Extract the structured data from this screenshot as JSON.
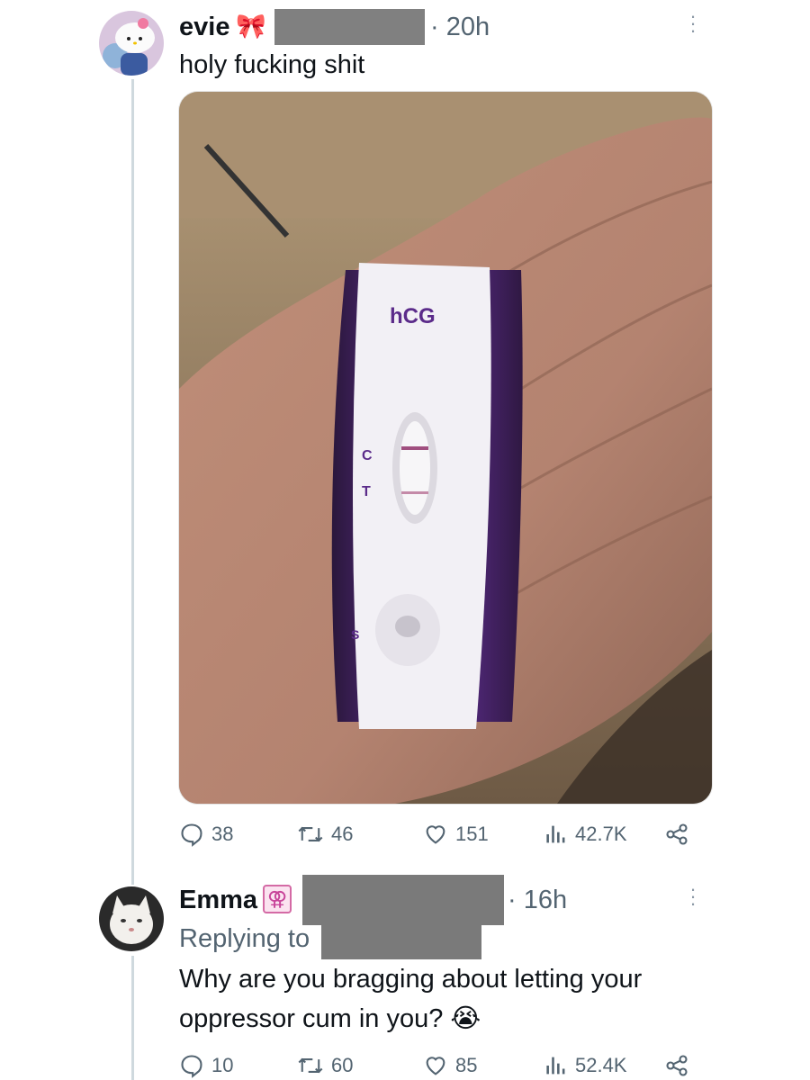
{
  "tweet1": {
    "name": "evie",
    "name_emoji": "🎀",
    "time": "· 20h",
    "text": "holy fucking shit",
    "media_labels": {
      "brand": "hCG",
      "c": "C",
      "t": "T",
      "s": "S"
    },
    "actions": {
      "replies": "38",
      "retweets": "46",
      "likes": "151",
      "views": "42.7K"
    }
  },
  "tweet2": {
    "name": "Emma",
    "name_emoji": "⚢",
    "time": "· 16h",
    "replying_to": "Replying to",
    "text_line1": "Why are you bragging about letting your",
    "text_line2": "oppressor cum in you? 😭",
    "actions": {
      "replies": "10",
      "retweets": "60",
      "likes": "85",
      "views": "52.4K"
    }
  },
  "colors": {
    "accent_gray": "#536471",
    "thread": "#cfd9de",
    "test_purple": "#5b2b8a"
  }
}
